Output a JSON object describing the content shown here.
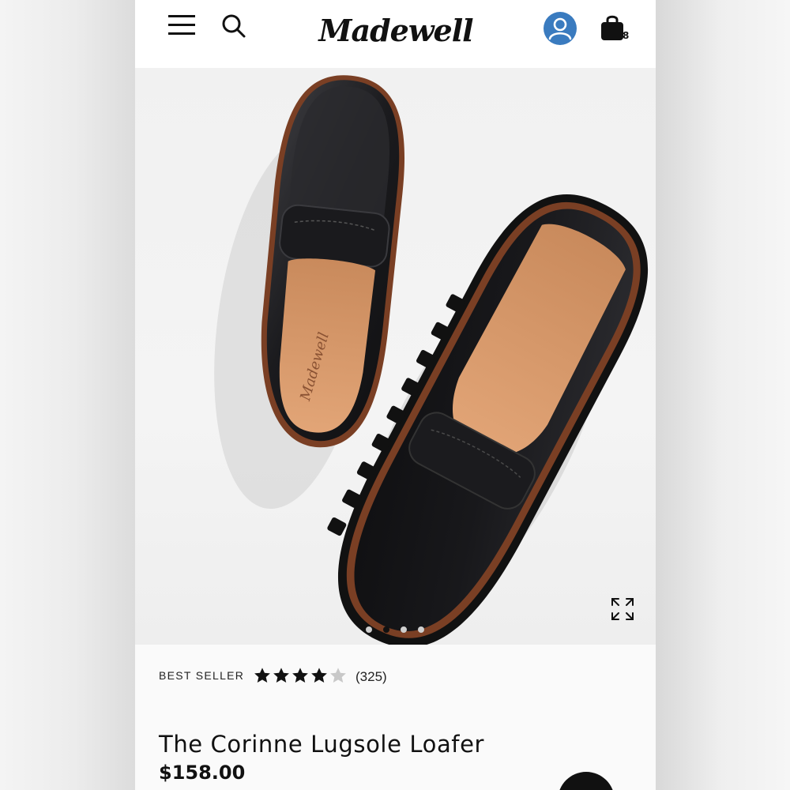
{
  "header": {
    "logo_text": "Madewell",
    "menu_icon": "hamburger-menu-icon",
    "search_icon": "search-icon",
    "account_icon": "account-icon",
    "bag_icon": "shopping-bag-icon",
    "bag_count": "8"
  },
  "gallery": {
    "image_subject": "black leather lugsole penny loafers",
    "expand_icon": "expand-icon",
    "slide_count": 4,
    "active_slide": 2
  },
  "product": {
    "badge": "BEST SELLER",
    "rating": 4,
    "rating_max": 5,
    "review_count": "(325)",
    "title": "The Corinne Lugsole Loafer",
    "price": "$158.00"
  },
  "colors": {
    "account_blue": "#3a7bbf",
    "text": "#111111",
    "empty_star": "#c8c8c8"
  }
}
